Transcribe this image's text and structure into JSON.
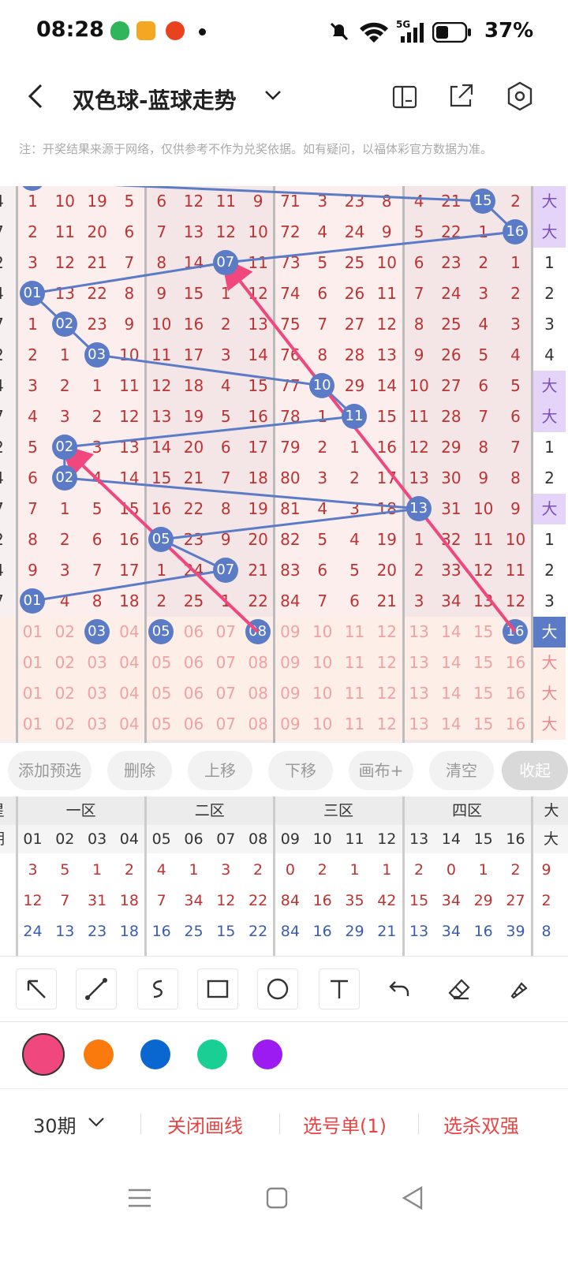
{
  "status": {
    "time": "08:28",
    "battery": "37%",
    "network": "5G"
  },
  "header": {
    "title": "双色球-蓝球走势"
  },
  "notice": "注：开奖结果来源于网络，仅供参考不作为兑奖依据。如有疑问，以福体彩官方数据为准。",
  "left_col": [
    "4",
    "7",
    "2",
    "4",
    "7",
    "2",
    "4",
    "7",
    "2",
    "4",
    "7",
    "2",
    "4",
    "7"
  ],
  "right_col": [
    "大",
    "大",
    "1",
    "2",
    "3",
    "4",
    "大",
    "大",
    "1",
    "2",
    "大",
    "1",
    "2",
    "3"
  ],
  "rows": [
    [
      "1",
      "10",
      "19",
      "5",
      "6",
      "12",
      "11",
      "9",
      "71",
      "3",
      "23",
      "8",
      "4",
      "21",
      "15",
      "2"
    ],
    [
      "2",
      "11",
      "20",
      "6",
      "7",
      "13",
      "12",
      "10",
      "72",
      "4",
      "24",
      "9",
      "5",
      "22",
      "1",
      "16"
    ],
    [
      "3",
      "12",
      "21",
      "7",
      "8",
      "14",
      "07",
      "11",
      "73",
      "5",
      "25",
      "10",
      "6",
      "23",
      "2",
      "1"
    ],
    [
      "01",
      "13",
      "22",
      "8",
      "9",
      "15",
      "1",
      "12",
      "74",
      "6",
      "26",
      "11",
      "7",
      "24",
      "3",
      "2"
    ],
    [
      "1",
      "02",
      "23",
      "9",
      "10",
      "16",
      "2",
      "13",
      "75",
      "7",
      "27",
      "12",
      "8",
      "25",
      "4",
      "3"
    ],
    [
      "2",
      "1",
      "03",
      "10",
      "11",
      "17",
      "3",
      "14",
      "76",
      "8",
      "28",
      "13",
      "9",
      "26",
      "5",
      "4"
    ],
    [
      "3",
      "2",
      "1",
      "11",
      "12",
      "18",
      "4",
      "15",
      "77",
      "10",
      "29",
      "14",
      "10",
      "27",
      "6",
      "5"
    ],
    [
      "4",
      "3",
      "2",
      "12",
      "13",
      "19",
      "5",
      "16",
      "78",
      "1",
      "11",
      "15",
      "11",
      "28",
      "7",
      "6"
    ],
    [
      "5",
      "02",
      "3",
      "13",
      "14",
      "20",
      "6",
      "17",
      "79",
      "2",
      "1",
      "16",
      "12",
      "29",
      "8",
      "7"
    ],
    [
      "6",
      "02",
      "4",
      "14",
      "15",
      "21",
      "7",
      "18",
      "80",
      "3",
      "2",
      "17",
      "13",
      "30",
      "9",
      "8"
    ],
    [
      "7",
      "1",
      "5",
      "15",
      "16",
      "22",
      "8",
      "19",
      "81",
      "4",
      "3",
      "18",
      "13",
      "31",
      "10",
      "9"
    ],
    [
      "8",
      "2",
      "6",
      "16",
      "05",
      "23",
      "9",
      "20",
      "82",
      "5",
      "4",
      "19",
      "1",
      "32",
      "11",
      "10"
    ],
    [
      "9",
      "3",
      "7",
      "17",
      "1",
      "24",
      "07",
      "21",
      "83",
      "6",
      "5",
      "20",
      "2",
      "33",
      "12",
      "11"
    ],
    [
      "01",
      "4",
      "8",
      "18",
      "2",
      "25",
      "1",
      "22",
      "84",
      "7",
      "6",
      "21",
      "3",
      "34",
      "13",
      "12"
    ]
  ],
  "balls": [
    [
      0,
      14
    ],
    [
      1,
      15
    ],
    [
      2,
      6
    ],
    [
      3,
      0
    ],
    [
      4,
      1
    ],
    [
      5,
      2
    ],
    [
      6,
      9
    ],
    [
      7,
      10
    ],
    [
      8,
      1
    ],
    [
      9,
      1
    ],
    [
      10,
      12
    ],
    [
      11,
      4
    ],
    [
      12,
      6
    ],
    [
      13,
      0
    ]
  ],
  "pick_rows": [
    {
      "cells": [
        "01",
        "02",
        "03",
        "04",
        "05",
        "06",
        "07",
        "08",
        "09",
        "10",
        "11",
        "12",
        "13",
        "14",
        "15",
        "16"
      ],
      "balls": [
        2,
        4,
        7,
        15
      ],
      "tail": "大"
    },
    {
      "cells": [
        "01",
        "02",
        "03",
        "04",
        "05",
        "06",
        "07",
        "08",
        "09",
        "10",
        "11",
        "12",
        "13",
        "14",
        "15",
        "16"
      ],
      "balls": [],
      "tail": "大"
    },
    {
      "cells": [
        "01",
        "02",
        "03",
        "04",
        "05",
        "06",
        "07",
        "08",
        "09",
        "10",
        "11",
        "12",
        "13",
        "14",
        "15",
        "16"
      ],
      "balls": [],
      "tail": "大"
    },
    {
      "cells": [
        "01",
        "02",
        "03",
        "04",
        "05",
        "06",
        "07",
        "08",
        "09",
        "10",
        "11",
        "12",
        "13",
        "14",
        "15",
        "16"
      ],
      "balls": [],
      "tail": "大"
    }
  ],
  "actions": [
    "添加预选",
    "删除",
    "上移",
    "下移",
    "画布+",
    "清空",
    "收起"
  ],
  "stats": {
    "left_head": [
      "星",
      "期"
    ],
    "zones": [
      "一区",
      "二区",
      "三区",
      "四区",
      "大"
    ],
    "cols": [
      "01",
      "02",
      "03",
      "04",
      "05",
      "06",
      "07",
      "08",
      "09",
      "10",
      "11",
      "12",
      "13",
      "14",
      "15",
      "16"
    ],
    "tail_head": "大",
    "rows": [
      {
        "lead": "-",
        "vals": [
          "3",
          "5",
          "1",
          "2",
          "4",
          "1",
          "3",
          "2",
          "0",
          "2",
          "1",
          "1",
          "2",
          "0",
          "1",
          "2"
        ],
        "tail": "9",
        "color": "#b33"
      },
      {
        "lead": "-",
        "vals": [
          "12",
          "7",
          "31",
          "18",
          "7",
          "34",
          "12",
          "22",
          "84",
          "16",
          "35",
          "42",
          "15",
          "34",
          "29",
          "27"
        ],
        "tail": "2",
        "color": "#b33"
      },
      {
        "lead": "-",
        "vals": [
          "24",
          "13",
          "23",
          "18",
          "16",
          "25",
          "15",
          "22",
          "84",
          "16",
          "29",
          "21",
          "13",
          "34",
          "16",
          "39"
        ],
        "tail": "8",
        "color": "#3a5db0"
      }
    ]
  },
  "colors": [
    "#f0477e",
    "#fb7a0e",
    "#0a67d0",
    "#19cf93",
    "#9b1bf1"
  ],
  "bottom": {
    "period": "30期",
    "btn1": "关闭画线",
    "btn2": "选号单(1)",
    "btn3": "选杀双强"
  }
}
